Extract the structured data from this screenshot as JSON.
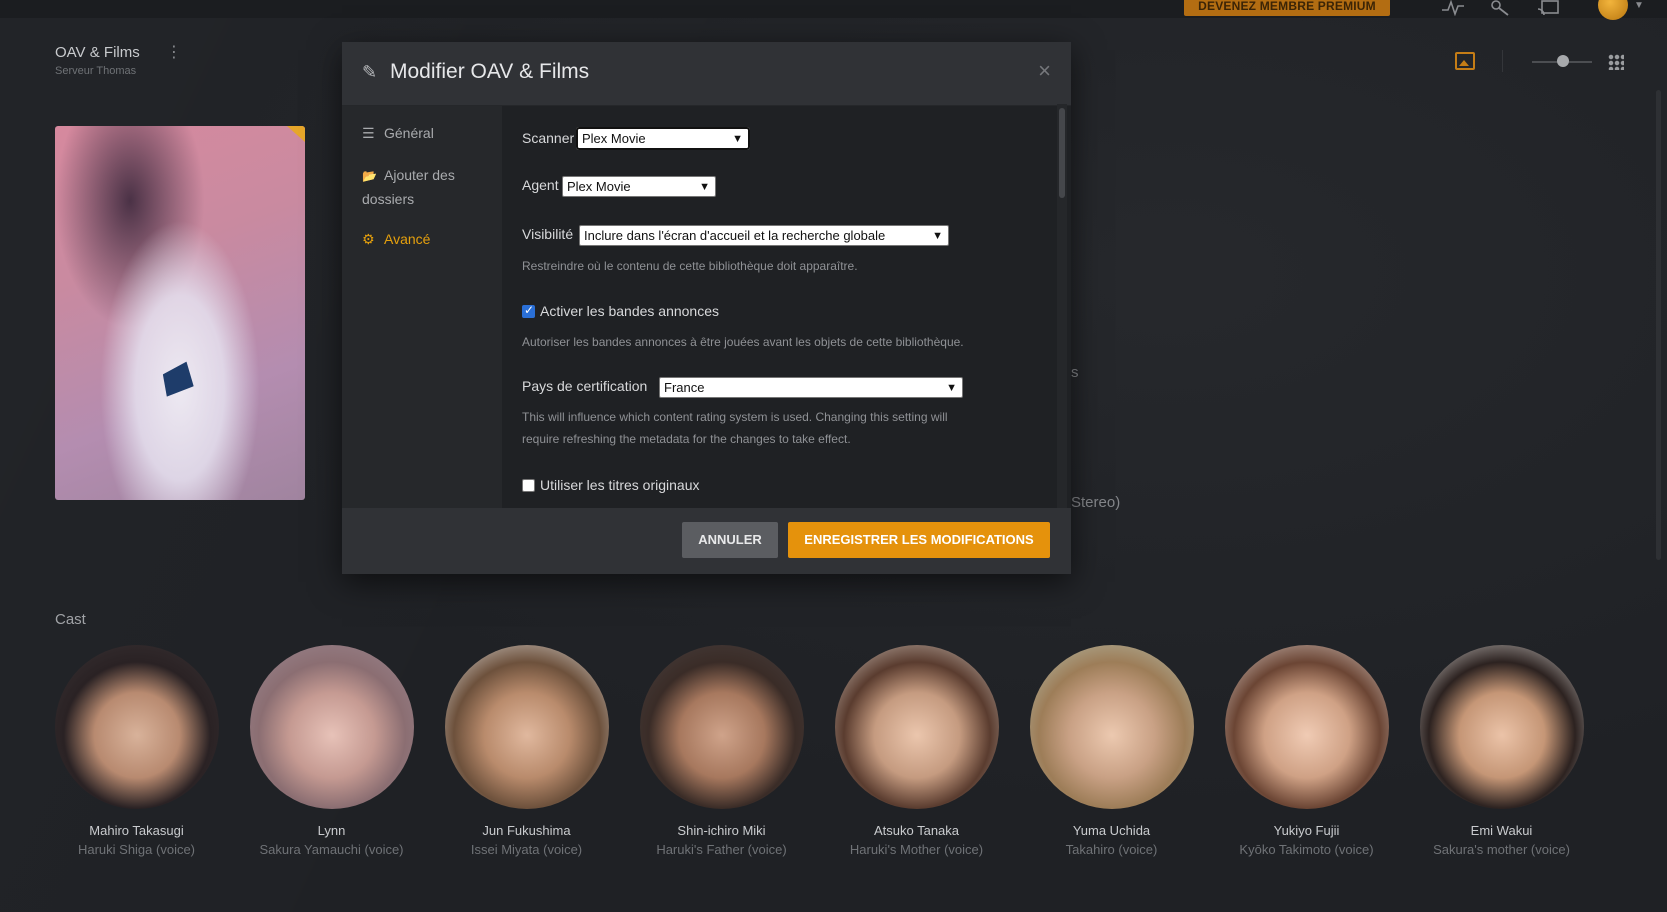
{
  "topbar": {
    "premium_label": "DEVENEZ MEMBRE PREMIUM",
    "icons": [
      "activity-icon",
      "tools-icon",
      "cast-icon",
      "user-avatar",
      "chevron-down-icon"
    ]
  },
  "library": {
    "title": "OAV & Films",
    "server": "Serveur Thomas",
    "more_glyph": "⋮"
  },
  "background_peek": {
    "text1": "s",
    "text2": "Stereo)"
  },
  "modal": {
    "title": "Modifier OAV & Films",
    "close_glyph": "×",
    "sidebar": [
      {
        "label": "Général",
        "icon": "list-icon",
        "glyph": "☰",
        "active": false
      },
      {
        "label": "Ajouter des dossiers",
        "icon": "folder-icon",
        "glyph": "📂",
        "active": false
      },
      {
        "label": "Avancé",
        "icon": "gear-icon",
        "glyph": "⚙",
        "active": true
      }
    ],
    "scanner": {
      "label": "Scanner",
      "value": "Plex Movie"
    },
    "agent": {
      "label": "Agent",
      "value": "Plex Movie"
    },
    "visibility": {
      "label": "Visibilité",
      "value": "Inclure dans l'écran d'accueil et la recherche globale",
      "help": "Restreindre où le contenu de cette bibliothèque doit apparaître."
    },
    "trailers": {
      "label": "Activer les bandes annonces",
      "checked": true,
      "help": "Autoriser les bandes annonces à être jouées avant les objets de cette bibliothèque."
    },
    "certification": {
      "label": "Pays de certification",
      "value": "France",
      "help_line1": "This will influence which content rating system is used. Changing this setting will",
      "help_line2": "require refreshing the metadata for the changes to take effect."
    },
    "original_titles": {
      "label": "Utiliser les titres originaux",
      "checked": false
    },
    "buttons": {
      "cancel": "ANNULER",
      "save": "ENREGISTRER LES MODIFICATIONS"
    }
  },
  "cast": {
    "title": "Cast",
    "members": [
      {
        "name": "Mahiro Takasugi",
        "role": "Haruki Shiga (voice)"
      },
      {
        "name": "Lynn",
        "role": "Sakura Yamauchi (voice)"
      },
      {
        "name": "Jun Fukushima",
        "role": "Issei Miyata (voice)"
      },
      {
        "name": "Shin-ichiro Miki",
        "role": "Haruki's Father (voice)"
      },
      {
        "name": "Atsuko Tanaka",
        "role": "Haruki's Mother (voice)"
      },
      {
        "name": "Yuma Uchida",
        "role": "Takahiro (voice)"
      },
      {
        "name": "Yukiyo Fujii",
        "role": "Kyōko Takimoto (voice)"
      },
      {
        "name": "Emi Wakui",
        "role": "Sakura's mother (voice)"
      }
    ]
  },
  "colors": {
    "accent": "#e5a00d",
    "save_button": "#e5920c",
    "cancel_button": "#5b5d61",
    "background": "#1f2125"
  }
}
